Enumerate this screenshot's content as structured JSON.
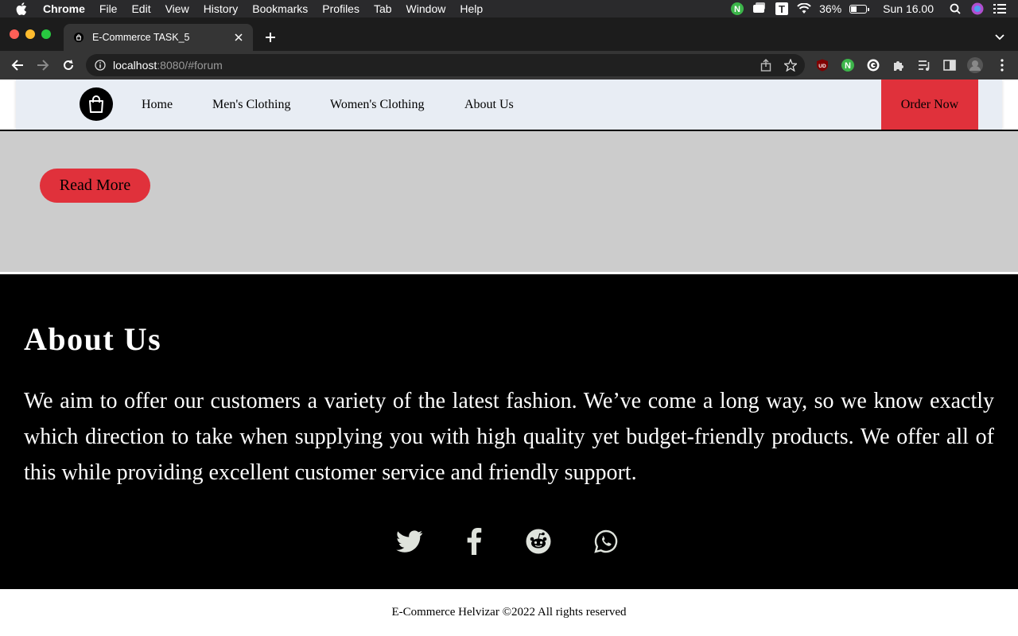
{
  "menubar": {
    "app": "Chrome",
    "items": [
      "File",
      "Edit",
      "View",
      "History",
      "Bookmarks",
      "Profiles",
      "Tab",
      "Window",
      "Help"
    ],
    "battery_percent": "36%",
    "battery_level": 0.36,
    "clock": "Sun 16.00"
  },
  "browser": {
    "tab_title": "E-Commerce TASK_5",
    "url_host": "localhost",
    "url_path": ":8080/#forum"
  },
  "nav": {
    "links": [
      "Home",
      "Men's Clothing",
      "Women's Clothing",
      "About Us"
    ],
    "order_label": "Order Now"
  },
  "hero": {
    "read_more_label": "Read More"
  },
  "about": {
    "title": "About Us",
    "text": "We aim to offer our customers a variety of the latest fashion. We’ve come a long way, so we know exactly which direction to take when supplying you with high quality yet budget-friendly products. We offer all of this while providing excellent customer service and friendly support.",
    "socials": [
      "twitter-icon",
      "facebook-icon",
      "reddit-icon",
      "whatsapp-icon"
    ]
  },
  "footer": {
    "text": "E-Commerce Helvizar ©2022 All rights reserved"
  },
  "colors": {
    "accent": "#e0313b",
    "nav_bg": "#e8edf4",
    "section_grey": "#cccccc"
  }
}
